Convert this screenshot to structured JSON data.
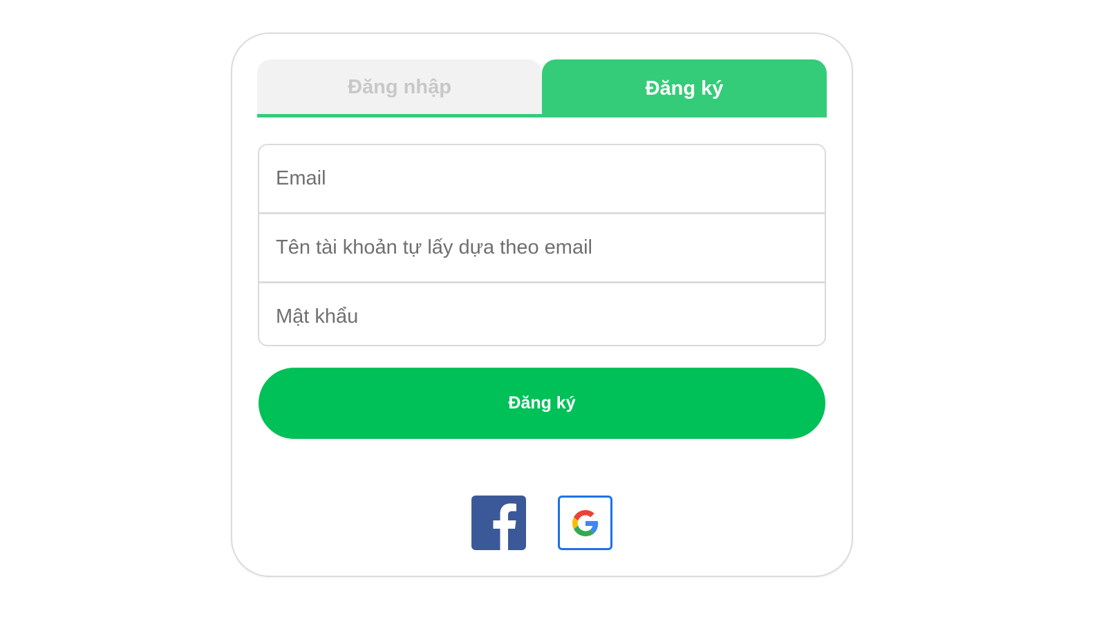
{
  "tabs": {
    "login_label": "Đăng nhập",
    "register_label": "Đăng ký",
    "active": "register"
  },
  "form": {
    "email_placeholder": "Email",
    "username_placeholder": "Tên tài khoản tự lấy dựa theo email",
    "password_placeholder": "Mật khẩu",
    "submit_label": "Đăng ký"
  },
  "social": {
    "icons": [
      "facebook-icon",
      "google-icon"
    ]
  },
  "colors": {
    "accent": "#34cc78",
    "button": "#00c058",
    "facebook": "#3b5998",
    "google_border": "#1a73e8"
  }
}
